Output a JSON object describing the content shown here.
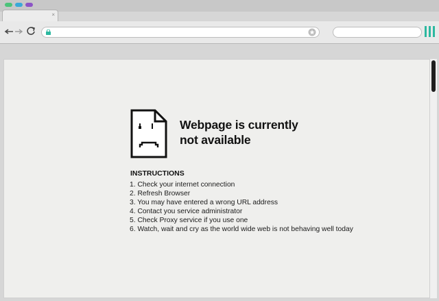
{
  "window": {
    "traffic_lights": [
      {
        "name": "close",
        "color": "#4cc37a"
      },
      {
        "name": "minimize",
        "color": "#3aa9d9"
      },
      {
        "name": "maximize",
        "color": "#8c54c6"
      }
    ]
  },
  "tab": {
    "close_glyph": "×"
  },
  "toolbar": {
    "back_glyph": "⟵",
    "forward_glyph": "⟶",
    "reload_glyph": "↻",
    "address_value": "",
    "search_value": "",
    "accent_color": "#2cb8a0"
  },
  "error_page": {
    "title_line1": "Webpage is currently",
    "title_line2": "not available",
    "instructions_heading": "INSTRUCTIONS",
    "instructions": [
      "1. Check your internet connection",
      "2. Refresh Browser",
      "3. You may have entered a wrong URL address",
      "4. Contact you service administrator",
      "5. Check Proxy service if you use one",
      "6. Watch, wait and cry as the world wide web is not behaving well today"
    ]
  }
}
